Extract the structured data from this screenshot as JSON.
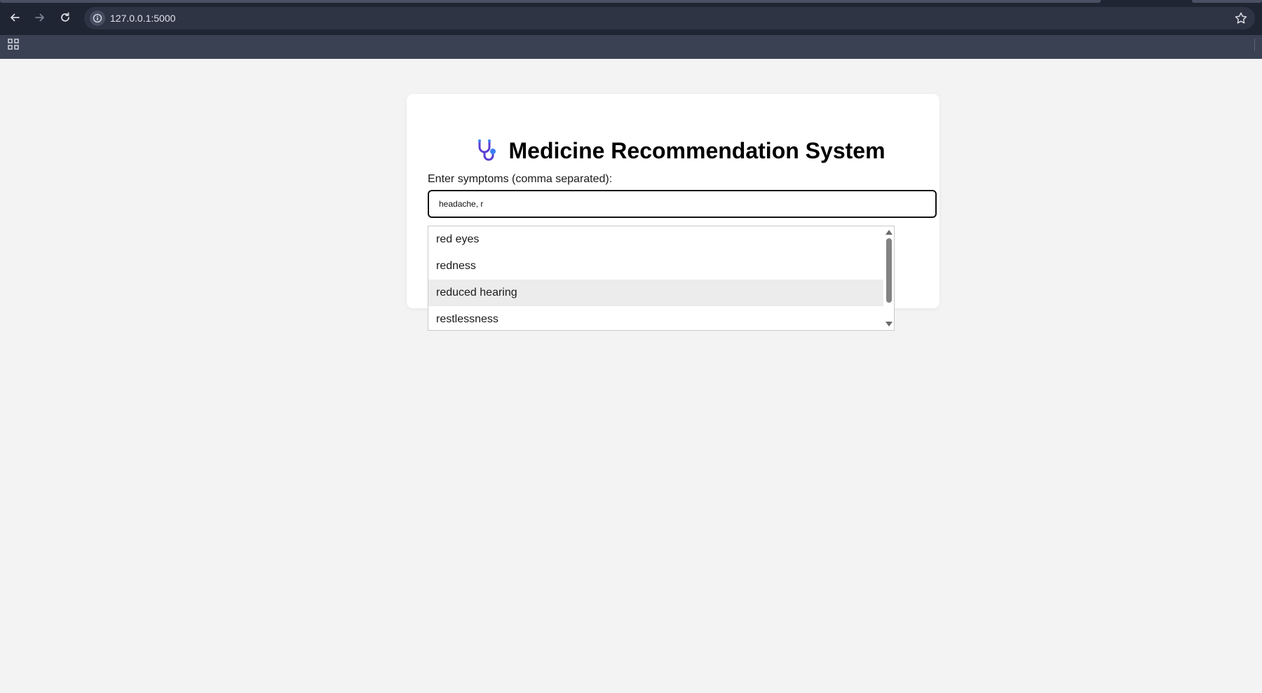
{
  "browser": {
    "url": "127.0.0.1:5000",
    "icons": {
      "back": "arrow-left-icon",
      "forward": "arrow-right-icon",
      "reload": "reload-icon",
      "info": "info-icon",
      "bookmark": "star-icon",
      "apps": "apps-grid-icon"
    }
  },
  "page": {
    "title": "Medicine Recommendation System",
    "title_icon": "stethoscope-icon",
    "symptoms_label": "Enter symptoms (comma separated):",
    "symptoms_value": "headache, r",
    "suggestions": [
      {
        "label": "red eyes",
        "highlighted": false
      },
      {
        "label": "redness",
        "highlighted": false
      },
      {
        "label": "reduced hearing",
        "highlighted": true
      },
      {
        "label": "restlessness",
        "highlighted": false
      }
    ]
  },
  "colors": {
    "chrome_dark": "#202533",
    "chrome_bar": "#3a4152",
    "page_bg": "#f3f3f3",
    "card_bg": "#ffffff",
    "stethoscope_purple": "#5b3fd1",
    "stethoscope_blue": "#3b82f6",
    "highlight": "#ececec"
  }
}
